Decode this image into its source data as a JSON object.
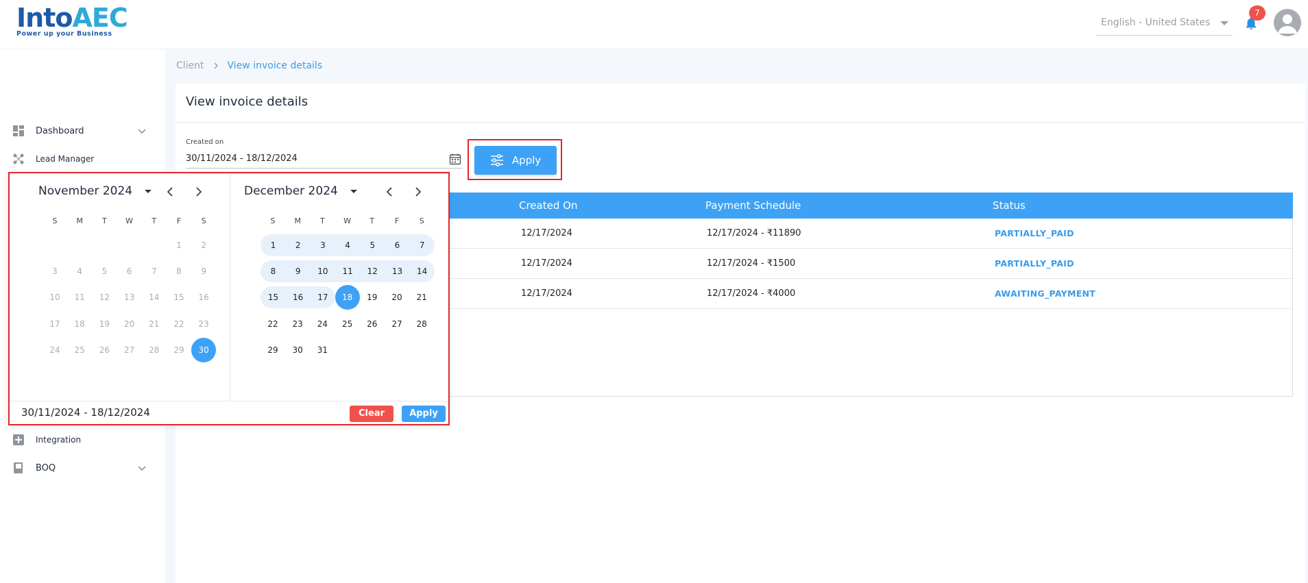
{
  "header": {
    "logo_main": "Into",
    "logo_accent": "AEC",
    "logo_tagline": "Power up your Business",
    "language": "English - United States",
    "notification_count": "7"
  },
  "sidebar": {
    "items": [
      {
        "label": "Dashboard",
        "icon": "dashboard-icon",
        "has_chevron": true
      },
      {
        "label": "Lead Manager",
        "icon": "lead-manager-icon",
        "has_chevron": false
      },
      {
        "label": "Integration",
        "icon": "plus-box-icon",
        "has_chevron": false
      },
      {
        "label": "BOQ",
        "icon": "book-icon",
        "has_chevron": true
      }
    ]
  },
  "breadcrumb": {
    "root": "Client",
    "current": "View invoice details"
  },
  "page": {
    "title": "View invoice details",
    "created_label": "Created on",
    "created_value": "30/11/2024 - 18/12/2024",
    "apply_label": "Apply"
  },
  "table": {
    "headers": [
      "Created On",
      "Payment Schedule",
      "Status"
    ],
    "rows": [
      {
        "created_on": "12/17/2024",
        "payment_schedule": "12/17/2024 - ₹11890",
        "status": "PARTIALLY_PAID"
      },
      {
        "created_on": "12/17/2024",
        "payment_schedule": "12/17/2024 - ₹1500",
        "status": "PARTIALLY_PAID"
      },
      {
        "created_on": "12/17/2024",
        "payment_schedule": "12/17/2024 - ₹4000",
        "status": "AWAITING_PAYMENT"
      }
    ]
  },
  "datepicker": {
    "left_month": "November 2024",
    "right_month": "December 2024",
    "weekdays": [
      "S",
      "M",
      "T",
      "W",
      "T",
      "F",
      "S"
    ],
    "range_text": "30/11/2024 - 18/12/2024",
    "clear_label": "Clear",
    "apply_label": "Apply",
    "selected_start": "30",
    "selected_end": "18"
  },
  "colors": {
    "primary": "#3da2f5",
    "danger": "#f0524b",
    "highlight_border": "#e2262b",
    "range_fill": "#e6f1fb"
  }
}
